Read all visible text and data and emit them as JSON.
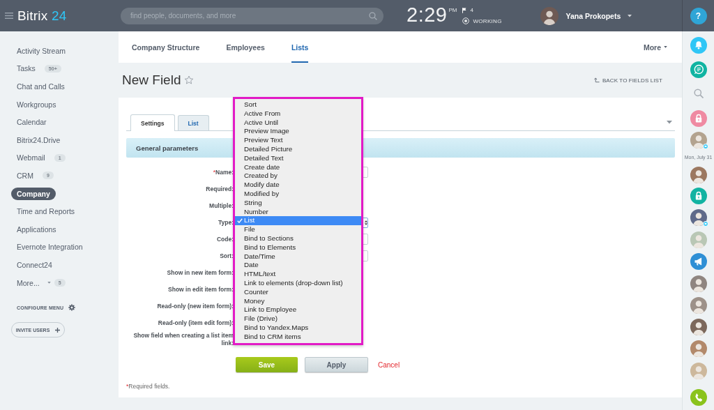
{
  "header": {
    "logo": {
      "word": "Bitrix",
      "number": "24"
    },
    "search": {
      "placeholder": "find people, documents, and more"
    },
    "clock": {
      "time": "2:29",
      "period": "PM"
    },
    "flags": "4",
    "status": "WORKING",
    "user": "Yana Prokopets"
  },
  "sidebar": {
    "items": [
      {
        "label": "Activity Stream",
        "selected": false
      },
      {
        "label": "Tasks",
        "badge": "50+",
        "selected": false
      },
      {
        "label": "Chat and Calls",
        "selected": false
      },
      {
        "label": "Workgroups",
        "selected": false
      },
      {
        "label": "Calendar",
        "selected": false
      },
      {
        "label": "Bitrix24.Drive",
        "selected": false
      },
      {
        "label": "Webmail",
        "badge": "1",
        "selected": false
      },
      {
        "label": "CRM",
        "badge": "9",
        "selected": false
      },
      {
        "label": "Company",
        "selected": true
      },
      {
        "label": "Time and Reports",
        "selected": false
      },
      {
        "label": "Applications",
        "selected": false
      },
      {
        "label": "Evernote Integration",
        "selected": false
      },
      {
        "label": "Connect24",
        "selected": false
      }
    ],
    "more": {
      "label": "More...",
      "badge": "5"
    },
    "configure": "CONFIGURE MENU",
    "invite": "INVITE USERS"
  },
  "tabs": [
    {
      "label": "Company Structure",
      "selected": false
    },
    {
      "label": "Employees",
      "selected": false
    },
    {
      "label": "Lists",
      "selected": true
    }
  ],
  "tabs_more": "More",
  "page": {
    "title": "New Field",
    "back": "BACK TO FIELDS LIST"
  },
  "form": {
    "tabs": [
      {
        "label": "Settings",
        "selected": true
      },
      {
        "label": "List",
        "selected": false
      }
    ],
    "section": "General parameters",
    "fields": [
      {
        "label": "Name:",
        "mark": "*",
        "kind": "input"
      },
      {
        "label": "Required:",
        "kind": "label"
      },
      {
        "label": "Multiple:",
        "kind": "label"
      },
      {
        "label": "Type:",
        "kind": "select"
      },
      {
        "label": "Code:",
        "kind": "input"
      },
      {
        "label": "Sort:",
        "kind": "input"
      },
      {
        "label": "Show in new item form:",
        "kind": "label"
      },
      {
        "label": "Show in edit item form:",
        "kind": "label"
      },
      {
        "label": "Read-only (new item form):",
        "kind": "label"
      },
      {
        "label": "Read-only (item edit form):",
        "kind": "label"
      },
      {
        "label": "Show field when creating a list item link:",
        "kind": "label"
      }
    ],
    "type_menu": {
      "options": [
        {
          "label": "Sort",
          "selected": false
        },
        {
          "label": "Active From",
          "selected": false
        },
        {
          "label": "Active Until",
          "selected": false
        },
        {
          "label": "Preview Image",
          "selected": false
        },
        {
          "label": "Preview Text",
          "selected": false
        },
        {
          "label": "Detailed Picture",
          "selected": false
        },
        {
          "label": "Detailed Text",
          "selected": false
        },
        {
          "label": "Create date",
          "selected": false
        },
        {
          "label": "Created by",
          "selected": false
        },
        {
          "label": "Modify date",
          "selected": false
        },
        {
          "label": "Modified by",
          "selected": false
        },
        {
          "label": "String",
          "selected": false
        },
        {
          "label": "Number",
          "selected": false
        },
        {
          "label": "List",
          "selected": true
        },
        {
          "label": "File",
          "selected": false
        },
        {
          "label": "Bind to Sections",
          "selected": false
        },
        {
          "label": "Bind to Elements",
          "selected": false
        },
        {
          "label": "Date/Time",
          "selected": false
        },
        {
          "label": "Date",
          "selected": false
        },
        {
          "label": "HTML/text",
          "selected": false
        },
        {
          "label": "Link to elements (drop-down list)",
          "selected": false
        },
        {
          "label": "Counter",
          "selected": false
        },
        {
          "label": "Money",
          "selected": false
        },
        {
          "label": "Link to Employee",
          "selected": false
        },
        {
          "label": "File (Drive)",
          "selected": false
        },
        {
          "label": "Bind to Yandex.Maps",
          "selected": false
        },
        {
          "label": "Bind to CRM items",
          "selected": false
        }
      ]
    },
    "buttons": [
      {
        "label": "Save",
        "kind": "primary"
      },
      {
        "label": "Apply",
        "kind": "secondary"
      },
      {
        "label": "Cancel",
        "kind": "link"
      }
    ],
    "note": {
      "mark": "*",
      "text": "Required fields."
    }
  },
  "right_bar": {
    "help": "?",
    "date": "Mon, July 31"
  }
}
